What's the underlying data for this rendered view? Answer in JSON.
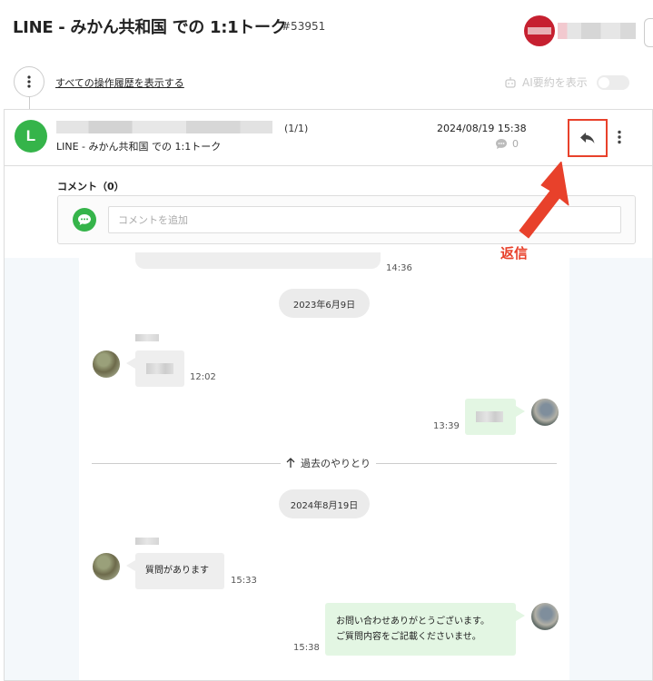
{
  "page": {
    "title": "LINE - みかん共和国 での 1:1トーク",
    "ticket_id": "#53951"
  },
  "toolbar": {
    "history_link": "すべての操作履歴を表示する",
    "ai_summary_label": "AI要約を表示",
    "ai_summary_enabled": false
  },
  "message": {
    "channel_badge": "L",
    "count": "(1/1)",
    "subject": "LINE - みかん共和国 での 1:1トーク",
    "date": "2024/08/19 15:38",
    "comment_count": "0"
  },
  "comments": {
    "label": "コメント（0）",
    "placeholder": "コメントを追加"
  },
  "chat": {
    "first_time": "14:36",
    "date1": "2023年6月9日",
    "in1_time": "12:02",
    "out1_time": "13:39",
    "past_label": "過去のやりとり",
    "date2": "2024年8月19日",
    "in2_text": "質問があります",
    "in2_time": "15:33",
    "out2_line1": "お問い合わせありがとうございます。",
    "out2_line2": "ご質問内容をご記載くださいませ。",
    "out2_time": "15:38"
  },
  "annotation": {
    "label": "返信",
    "color": "#e8412b"
  },
  "colors": {
    "line_green": "#35b44a",
    "outgoing_bubble": "#e3f6e3",
    "incoming_bubble": "#eeeeee"
  }
}
